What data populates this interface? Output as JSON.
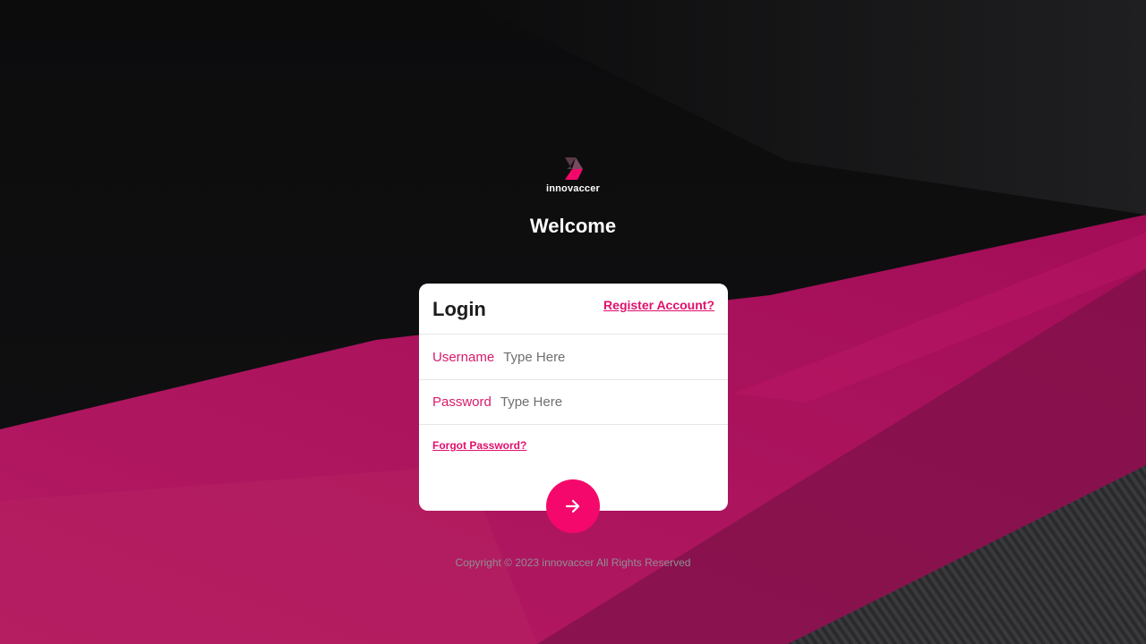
{
  "brand": {
    "name": "innovaccer",
    "accent_color": "#f5086b",
    "link_color": "#e0106c",
    "label_color": "#d81b6a"
  },
  "welcome": "Welcome",
  "login": {
    "title": "Login",
    "register_link": "Register Account?",
    "username_label": "Username",
    "username_placeholder": "Type Here",
    "username_value": "",
    "password_label": "Password",
    "password_placeholder": "Type Here",
    "password_value": "",
    "forgot_link": "Forgot Password?",
    "submit_icon": "arrow-right-icon"
  },
  "footer": {
    "copyright": "Copyright © 2023 innovaccer All Rights Reserved"
  }
}
